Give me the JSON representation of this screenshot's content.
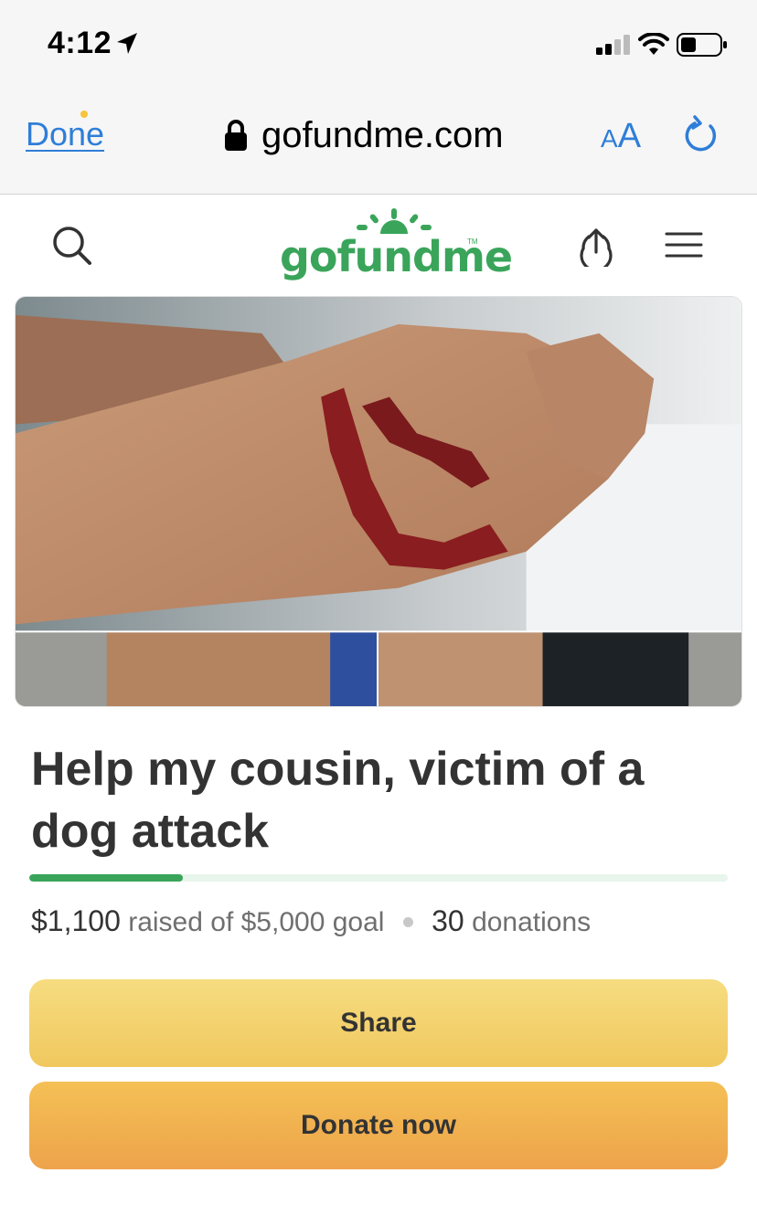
{
  "status_bar": {
    "time": "4:12",
    "icons": [
      "location-arrow-icon",
      "cellular-signal-icon",
      "wifi-icon",
      "battery-icon"
    ]
  },
  "browser": {
    "done_label": "Done",
    "url": "gofundme.com",
    "text_size_small": "A",
    "text_size_big": "A",
    "icons": [
      "lock-icon",
      "reload-icon"
    ]
  },
  "site_header": {
    "logo_text": "gofundme",
    "logo_tm": "TM",
    "icons": [
      "search-icon",
      "share-upload-icon",
      "hamburger-menu-icon"
    ]
  },
  "campaign": {
    "title": "Help my cousin, victim of a dog attack",
    "raised_amount": "$1,100",
    "raised_text": "raised of $5,000 goal",
    "donation_count": "30",
    "donation_text": "donations",
    "progress_fraction": 0.22
  },
  "actions": {
    "share_label": "Share",
    "donate_label": "Donate now"
  },
  "colors": {
    "brand_green": "#3aa55a",
    "link_blue": "#2f7ed8",
    "share_yellow": "#f3d26e",
    "donate_orange": "#f0b050"
  }
}
